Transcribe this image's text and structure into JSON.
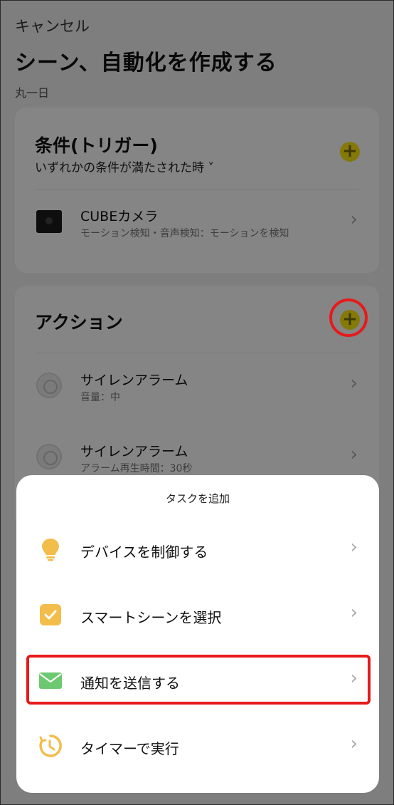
{
  "header": {
    "cancel_label": "キャンセル",
    "title": "シーン、自動化を作成する",
    "schedule": "丸一日"
  },
  "conditions": {
    "title": "条件(トリガー)",
    "subtitle": "いずれかの条件が満たされた時 ˅",
    "items": [
      {
        "name": "CUBEカメラ",
        "detail": "モーション検知・音声検知：モーションを検知"
      }
    ]
  },
  "actions": {
    "title": "アクション",
    "items": [
      {
        "name": "サイレンアラーム",
        "detail": "音量：中"
      },
      {
        "name": "サイレンアラーム",
        "detail": "アラーム再生時間：30秒"
      }
    ]
  },
  "sheet": {
    "title": "タスクを追加",
    "items": [
      {
        "label": "デバイスを制御する",
        "icon": "lightbulb-icon"
      },
      {
        "label": "スマートシーンを選択",
        "icon": "checkbox-icon"
      },
      {
        "label": "通知を送信する",
        "icon": "envelope-icon"
      },
      {
        "label": "タイマーで実行",
        "icon": "timer-icon"
      }
    ]
  },
  "colors": {
    "accent_yellow": "#ffe815",
    "highlight_red": "#e61a1a",
    "icon_orange": "#f2bd4a",
    "icon_green": "#6cc96f"
  }
}
